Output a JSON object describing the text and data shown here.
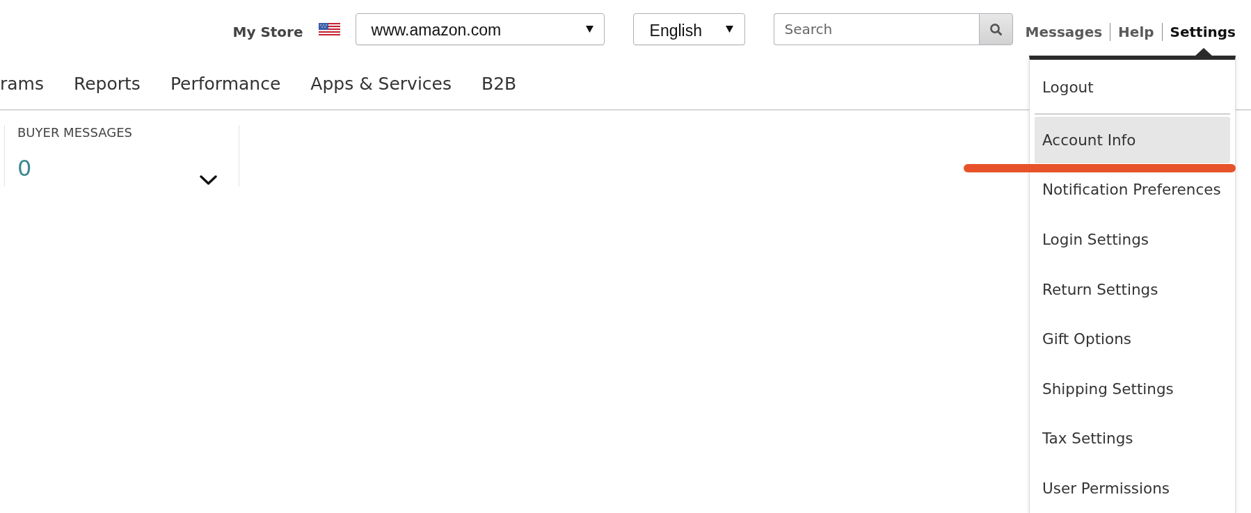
{
  "top_bar": {
    "store_label": "My Store",
    "marketplace_select": {
      "value": "www.amazon.com"
    },
    "language_select": {
      "value": "English"
    },
    "search": {
      "placeholder": "Search"
    },
    "links": [
      {
        "label": "Messages",
        "selected": false
      },
      {
        "label": "Help",
        "selected": false
      },
      {
        "label": "Settings",
        "selected": true
      }
    ]
  },
  "nav": {
    "items": [
      {
        "label": "rams"
      },
      {
        "label": "Reports"
      },
      {
        "label": "Performance"
      },
      {
        "label": "Apps & Services"
      },
      {
        "label": "B2B"
      }
    ]
  },
  "widgets": [
    {
      "label": "BUYER MESSAGES",
      "value": "0",
      "expanded": false
    }
  ],
  "settings_menu": {
    "groups": [
      {
        "items": [
          {
            "label": "Logout",
            "selected": false,
            "underlined": false
          }
        ]
      },
      {
        "items": [
          {
            "label": "Account Info",
            "selected": true,
            "underlined": true
          },
          {
            "label": "Notification Preferences",
            "selected": false,
            "underlined": false
          },
          {
            "label": "Login Settings",
            "selected": false,
            "underlined": false
          },
          {
            "label": "Return Settings",
            "selected": false,
            "underlined": false
          },
          {
            "label": "Gift Options",
            "selected": false,
            "underlined": false
          },
          {
            "label": "Shipping Settings",
            "selected": false,
            "underlined": false
          },
          {
            "label": "Tax Settings",
            "selected": false,
            "underlined": false
          },
          {
            "label": "User Permissions",
            "selected": false,
            "underlined": false
          }
        ]
      }
    ]
  }
}
